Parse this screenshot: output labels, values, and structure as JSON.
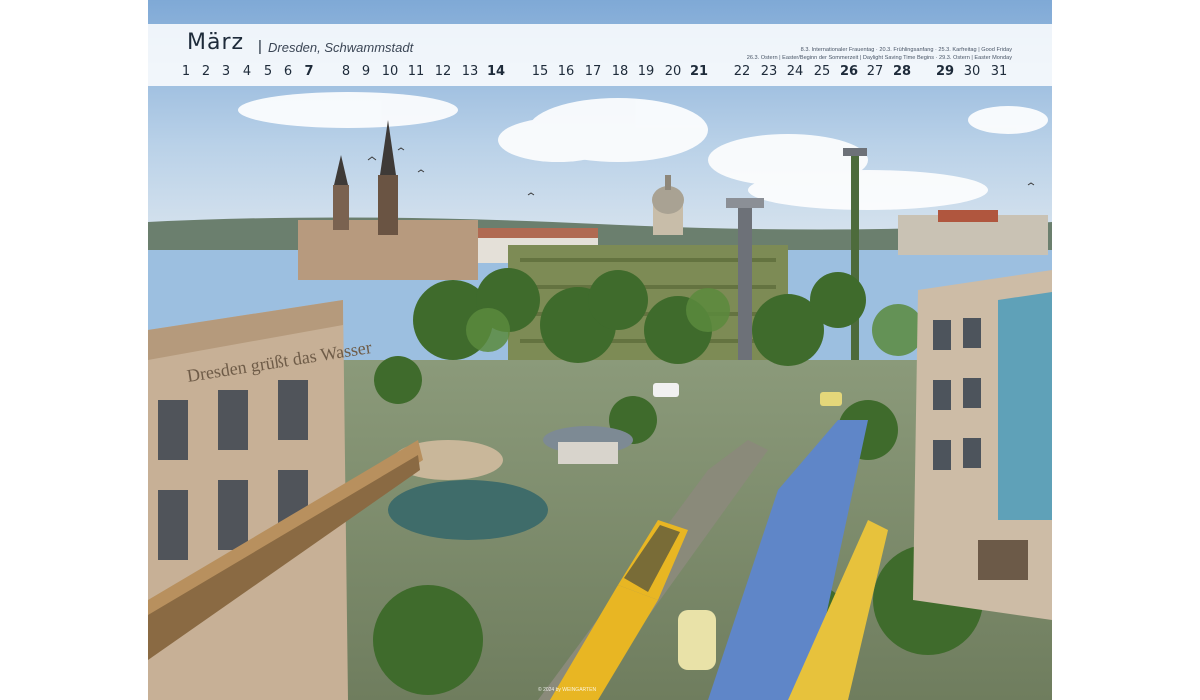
{
  "calendar": {
    "month": "März",
    "separator": "|",
    "subtitle": "Dresden, Schwammstadt",
    "notes": [
      "8.3. Internationaler Frauentag · 20.3. Frühlingsanfang · 25.3. Karfreitag | Good Friday",
      "26.3. Ostern | Easter/Beginn der Sommerzeit | Daylight Saving Time Begins · 29.3. Ostern | Easter Monday"
    ],
    "days": [
      {
        "n": "1",
        "bold": false
      },
      {
        "n": "2",
        "bold": false
      },
      {
        "n": "3",
        "bold": false
      },
      {
        "n": "4",
        "bold": false
      },
      {
        "n": "5",
        "bold": false
      },
      {
        "n": "6",
        "bold": false
      },
      {
        "n": "7",
        "bold": true
      },
      {
        "n": "8",
        "bold": false
      },
      {
        "n": "9",
        "bold": false
      },
      {
        "n": "10",
        "bold": false
      },
      {
        "n": "11",
        "bold": false
      },
      {
        "n": "12",
        "bold": false
      },
      {
        "n": "13",
        "bold": false
      },
      {
        "n": "14",
        "bold": true
      },
      {
        "n": "15",
        "bold": false
      },
      {
        "n": "16",
        "bold": false
      },
      {
        "n": "17",
        "bold": false
      },
      {
        "n": "18",
        "bold": false
      },
      {
        "n": "19",
        "bold": false
      },
      {
        "n": "20",
        "bold": false
      },
      {
        "n": "21",
        "bold": true
      },
      {
        "n": "22",
        "bold": false
      },
      {
        "n": "23",
        "bold": false
      },
      {
        "n": "24",
        "bold": false
      },
      {
        "n": "25",
        "bold": false
      },
      {
        "n": "26",
        "bold": true
      },
      {
        "n": "27",
        "bold": false
      },
      {
        "n": "28",
        "bold": true
      },
      {
        "n": "29",
        "bold": true
      },
      {
        "n": "30",
        "bold": false
      },
      {
        "n": "31",
        "bold": false
      }
    ]
  },
  "scene": {
    "building_sign": "Dresden grüßt das Wasser"
  },
  "credit": "© 2024 by WEINGARTEN",
  "colors": {
    "sky": "#9cbfe0",
    "header_band": "#ffffff",
    "text": "#1e2b3a",
    "tram": "#e8b623",
    "bike_lane": "#5f86c8",
    "greenery": "#4f7a34"
  }
}
